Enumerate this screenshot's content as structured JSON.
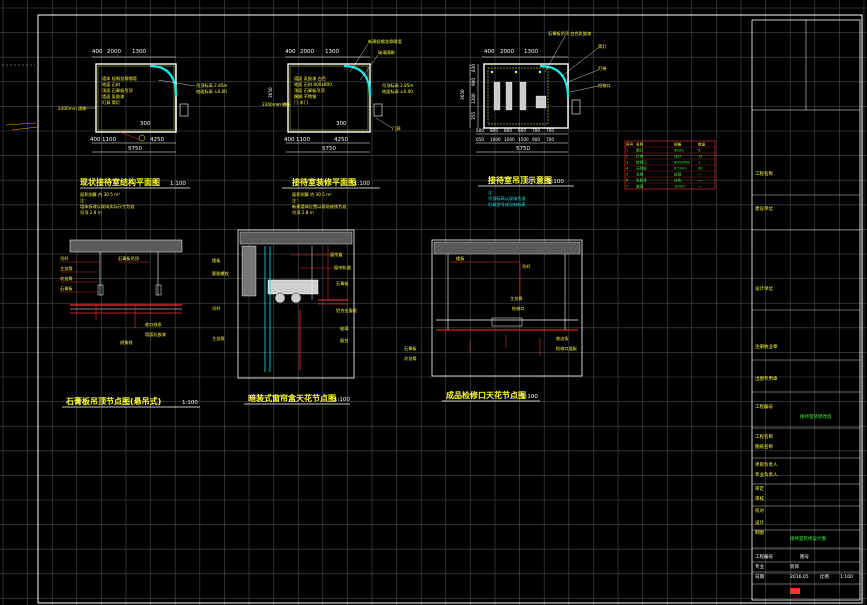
{
  "sheet": {
    "colors": {
      "background": "#000000",
      "grid": "#4a4e57",
      "frame": "#ffffff",
      "yellow": "#ffff3c",
      "cyan": "#19e6e6",
      "red": "#ff3030",
      "magenta": "#ff50ff",
      "green": "#3cff3c"
    }
  },
  "plan1": {
    "dims_top": [
      "400",
      "2000",
      "1300"
    ],
    "dims_bottom": [
      "400",
      "1100",
      "4250",
      "5750"
    ],
    "left_note": "2400mm 隔断",
    "side_dim": "3650",
    "title": "现状接待室结构平面图",
    "scale": "1:100",
    "notes": [
      "面积测算 约 30.5 m²",
      "注：",
      "墙体拆改以现场实际尺寸为准",
      "吊顶 2.8 m"
    ]
  },
  "plan2": {
    "dims_top": [
      "400",
      "2000",
      "1300"
    ],
    "dims_bottom": [
      "400",
      "1100",
      "4250",
      "5750"
    ],
    "left_note": "2300mm 隔断",
    "side_dim": "3650",
    "callouts": [
      "新建轻钢龙骨隔墙",
      "玻璃隔断",
      "门洞"
    ],
    "title": "接待室装修平面图",
    "scale": "1:100",
    "notes": [
      "面积测算 约 30.5 m²",
      "注：",
      "新建墙体位置以现场放线为准",
      "吊顶 2.8 m"
    ]
  },
  "plan3": {
    "dims_top": [
      "400",
      "2000",
      "1300"
    ],
    "dims_bottom_row1": [
      "500",
      "800",
      "800",
      "600",
      "700",
      "700"
    ],
    "dims_bottom_row2": [
      "650",
      "1000",
      "1000",
      "1500",
      "900",
      "700"
    ],
    "total": "5750",
    "side_dims": [
      "3650",
      "355",
      "1200",
      "900",
      "830"
    ],
    "callouts": [
      "石膏板吊顶 白色乳胶漆",
      "筒灯",
      "灯带",
      "检修口"
    ],
    "title": "接待室吊顶示意图",
    "scale": "1:100",
    "notes": [
      "注：",
      "吊顶标高以现场为准",
      "灯具型号详见材料表"
    ]
  },
  "legend_table": {
    "header": [
      "序号",
      "名称",
      "规格",
      "数量"
    ],
    "rows": [
      [
        "1",
        "筒灯",
        "Φ100",
        "8"
      ],
      [
        "2",
        "灯带",
        "LED",
        "12"
      ],
      [
        "3",
        "检修口",
        "450x450",
        "1"
      ],
      [
        "4",
        "石膏板",
        "9.5mm",
        "30"
      ],
      [
        "5",
        "龙骨",
        "轻钢",
        "—"
      ],
      [
        "6",
        "乳胶漆",
        "白色",
        "—"
      ],
      [
        "7",
        "玻璃",
        "10mm",
        "—"
      ]
    ]
  },
  "detail1": {
    "labels": [
      "吊杆",
      "主龙骨",
      "次龙骨",
      "石膏板",
      "石膏板吊顶",
      "收口线条",
      "墙面乳胶漆",
      "阴角线"
    ],
    "title": "石膏板吊顶节点图(悬吊式)",
    "scale": "1:100"
  },
  "detail2": {
    "labels": [
      "楼板",
      "膨胀螺栓",
      "吊杆",
      "主龙骨",
      "窗帘盒",
      "窗帘轨道",
      "石膏板",
      "铝合金窗框",
      "玻璃",
      "窗台"
    ],
    "title": "暗装式窗帘盒天花节点图",
    "scale": "1:100"
  },
  "detail3": {
    "labels": [
      "楼板",
      "吊杆",
      "主龙骨",
      "检修口",
      "石膏板",
      "次龙骨",
      "收边条",
      "检修口盖板"
    ],
    "title": "成品检修口天花节点图",
    "scale": "1:100"
  },
  "titleblock": {
    "rows": [
      "工程名称",
      "建设单位",
      "设计单位",
      "注册执业章",
      "出图专用章",
      "工程编号",
      "工程名称",
      "图纸名称",
      "项目负责人",
      "专业负责人",
      "审定",
      "审核",
      "校对",
      "设计",
      "制图"
    ],
    "project": "接待室装修改造",
    "drawing_name": "接待室装修设计图",
    "cells": [
      "工程编号",
      "图号",
      "专业",
      "装饰",
      "日期",
      "2016.05",
      "比例",
      "1:100"
    ]
  }
}
